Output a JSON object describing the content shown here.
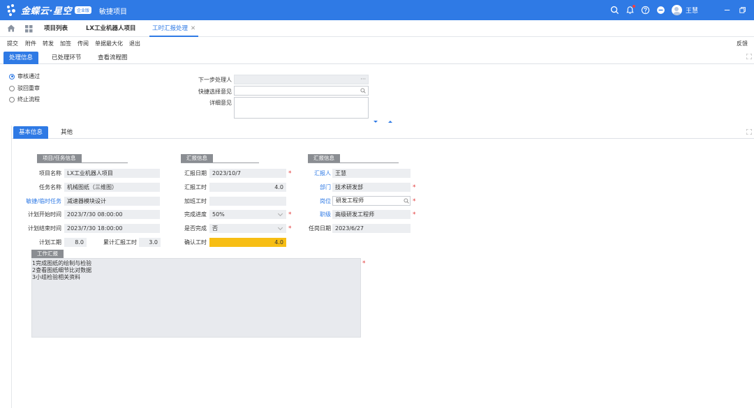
{
  "header": {
    "logo_text": "金蝶云·星空",
    "logo_badge": "企业版",
    "app_title": "敏捷项目",
    "user_name": "王慧",
    "icons": [
      "search-icon",
      "bell-icon",
      "help-icon",
      "minus-circle-icon",
      "avatar",
      "minimize-icon",
      "restore-icon"
    ],
    "accent": "#2f7ae5"
  },
  "page_tabs": [
    {
      "label": "项目列表"
    },
    {
      "label": "LX工业机器人项目"
    },
    {
      "label": "工时汇报处理",
      "close": "✕"
    }
  ],
  "actions": [
    "提交",
    "附件",
    "转发",
    "加签",
    "传阅",
    "单据最大化",
    "退出"
  ],
  "feedback": "反馈",
  "process_tabs": [
    "处理信息",
    "已处理环节",
    "查看流程图"
  ],
  "approval": {
    "options": [
      "审核通过",
      "驳回重审",
      "终止流程"
    ],
    "next_handler_label": "下一步处理人",
    "next_handler_dots": "···",
    "quick_opinion_label": "快捷选择意见",
    "detail_opinion_label": "详细意见"
  },
  "inner_tabs": [
    "基本信息",
    "其他"
  ],
  "project_info": {
    "title": "项目/任务信息",
    "project_name_label": "项目名称",
    "project_name": "LX工业机器人项目",
    "task_name_label": "任务名称",
    "task_name": "机械图纸（三维图）",
    "agile_task_label": "敏捷/临时任务",
    "agile_task": "减速器模块设计",
    "plan_start_label": "计划开始时间",
    "plan_start": "2023/7/30 08:00:00",
    "plan_end_label": "计划结束时间",
    "plan_end": "2023/7/30 18:00:00",
    "plan_hours_label": "计划工期",
    "plan_hours": "8.0",
    "total_hours_label": "累计汇报工时",
    "total_hours": "3.0"
  },
  "report_info": {
    "title": "汇报信息",
    "report_date_label": "汇报日期",
    "report_date": "2023/10/7",
    "report_hours_label": "汇报工时",
    "report_hours": "4.0",
    "overtime_label": "加班工时",
    "overtime": "",
    "progress_label": "完成进度",
    "progress": "50%",
    "done_label": "是否完成",
    "done": "否",
    "confirm_hours_label": "确认工时",
    "confirm_hours": "4.0",
    "highlight_color": "#f7be14"
  },
  "reporter_info": {
    "title": "汇报信息",
    "reporter_label": "汇报人",
    "reporter": "王慧",
    "dept_label": "部门",
    "dept": "技术研发部",
    "position_label": "岗位",
    "position": "研发工程师",
    "rank_label": "职级",
    "rank": "高级研发工程师",
    "hire_date_label": "任岗日期",
    "hire_date": "2023/6/27"
  },
  "work_report": {
    "title": "工作汇报",
    "lines": [
      "1完成图纸的绘制与检验",
      "2查看图纸细节比对数据",
      "3小组检验相关资料"
    ]
  },
  "required_mark": "*"
}
